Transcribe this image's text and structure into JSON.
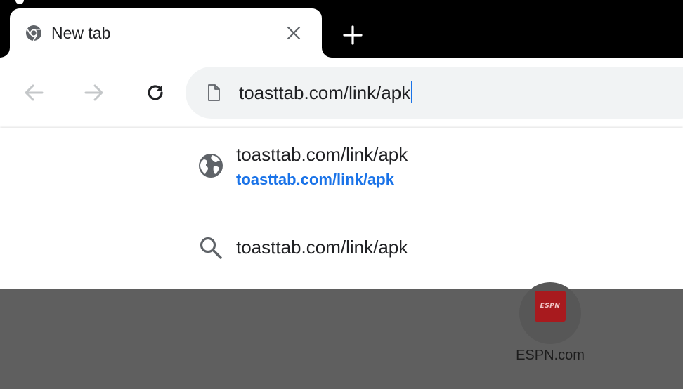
{
  "tab": {
    "title": "New tab",
    "favicon": "chrome-icon",
    "close_icon": "close-icon"
  },
  "tabstrip": {
    "new_tab_icon": "plus-icon"
  },
  "toolbar": {
    "back_icon": "arrow-left-icon",
    "forward_icon": "arrow-right-icon",
    "reload_icon": "reload-icon"
  },
  "omnibox": {
    "value": "toasttab.com/link/apk",
    "page_icon": "page-icon"
  },
  "suggestions": [
    {
      "icon": "globe-icon",
      "title": "toasttab.com/link/apk",
      "url": "toasttab.com/link/apk"
    },
    {
      "icon": "search-icon",
      "title": "toasttab.com/link/apk"
    }
  ],
  "ntp": {
    "tiles": [
      {
        "logo_text": "ESPN",
        "label": "ESPN.com"
      }
    ]
  },
  "colors": {
    "accent": "#1a73e8",
    "text": "#202124",
    "omnibox_bg": "#f1f3f4",
    "scrim": "#5f5f5f",
    "espn_red": "#a81a1e"
  }
}
